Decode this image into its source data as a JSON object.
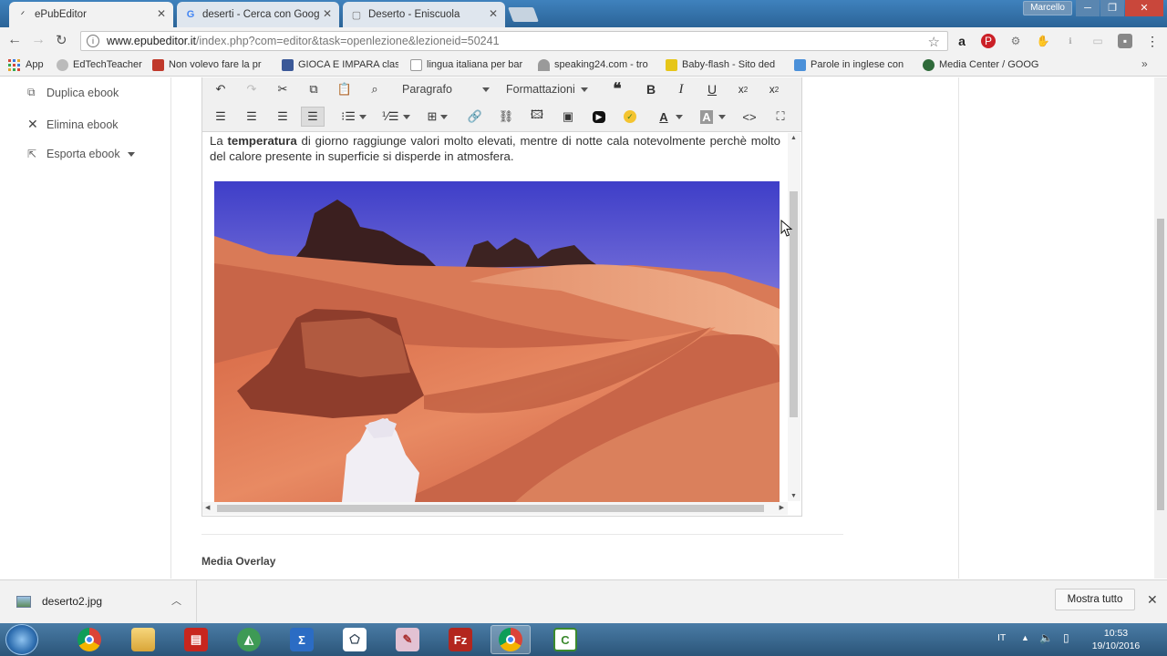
{
  "browser": {
    "tabs": [
      {
        "title": "ePubEditor"
      },
      {
        "title": "deserti - Cerca con Goog"
      },
      {
        "title": "Deserto - Eniscuola"
      }
    ],
    "user": "Marcello",
    "url_host": "www.epubeditor.it",
    "url_path": "/index.php?com=editor&task=openlezione&lezioneid=50241",
    "bookmarks": [
      {
        "label": "App",
        "color": "#d64937"
      },
      {
        "label": "EdTechTeacher",
        "color": "#888888"
      },
      {
        "label": "Non volevo fare la pr",
        "color": "#c0392b"
      },
      {
        "label": "GIOCA E IMPARA clas",
        "color": "#3b5998"
      },
      {
        "label": "lingua italiana per bar",
        "color": "#999999"
      },
      {
        "label": "speaking24.com - tro",
        "color": "#7a7a7a"
      },
      {
        "label": "Baby-flash - Sito ded",
        "color": "#e6c619"
      },
      {
        "label": "Parole in inglese con",
        "color": "#4a90d9"
      },
      {
        "label": "Media Center / GOOG",
        "color": "#2f6a3a"
      }
    ]
  },
  "sidebar": {
    "items": [
      {
        "label": "Duplica ebook",
        "icon": "copy-icon"
      },
      {
        "label": "Elimina ebook",
        "icon": "close-icon"
      },
      {
        "label": "Esporta ebook",
        "icon": "export-icon"
      }
    ]
  },
  "editor": {
    "paragraph_dropdown": "Paragrafo",
    "format_dropdown": "Formattazioni",
    "content": {
      "prefix": "La ",
      "bold": "temperatura",
      "rest": " di giorno raggiunge valori molto elevati, mentre di notte cala notevolmente perchè molto del calore presente in superficie si disperde in atmosfera."
    },
    "image_alt": "desert-photo"
  },
  "section": {
    "media_overlay": "Media Overlay"
  },
  "downloads": {
    "file": "deserto2.jpg",
    "show_all": "Mostra tutto"
  },
  "taskbar": {
    "language": "IT",
    "time": "10:53",
    "date": "19/10/2016"
  }
}
